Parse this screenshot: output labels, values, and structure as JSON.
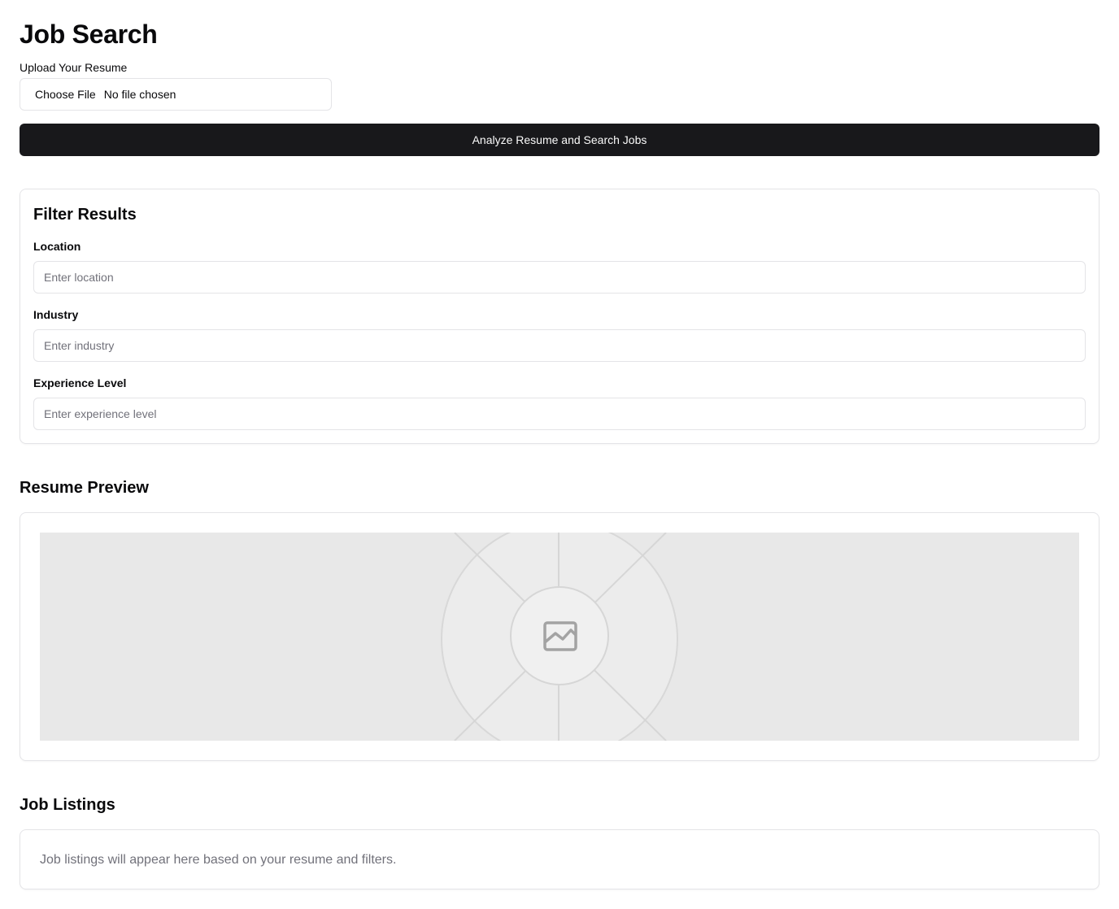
{
  "header": {
    "title": "Job Search"
  },
  "upload": {
    "label": "Upload Your Resume",
    "button_label": "Choose File",
    "status": "No file chosen"
  },
  "analyze_button_label": "Analyze Resume and Search Jobs",
  "filters": {
    "title": "Filter Results",
    "location": {
      "label": "Location",
      "placeholder": "Enter location",
      "value": ""
    },
    "industry": {
      "label": "Industry",
      "placeholder": "Enter industry",
      "value": ""
    },
    "experience": {
      "label": "Experience Level",
      "placeholder": "Enter experience level",
      "value": ""
    }
  },
  "resume_preview": {
    "heading": "Resume Preview",
    "icon": "image-placeholder-icon"
  },
  "job_listings": {
    "heading": "Job Listings",
    "empty_message": "Job listings will appear here based on your resume and filters."
  },
  "colors": {
    "primary_button": "#18181b",
    "primary_button_text": "#fafafa",
    "border": "#e4e4e7",
    "muted_text": "#71717a",
    "placeholder_bg": "#e8e8e8"
  }
}
